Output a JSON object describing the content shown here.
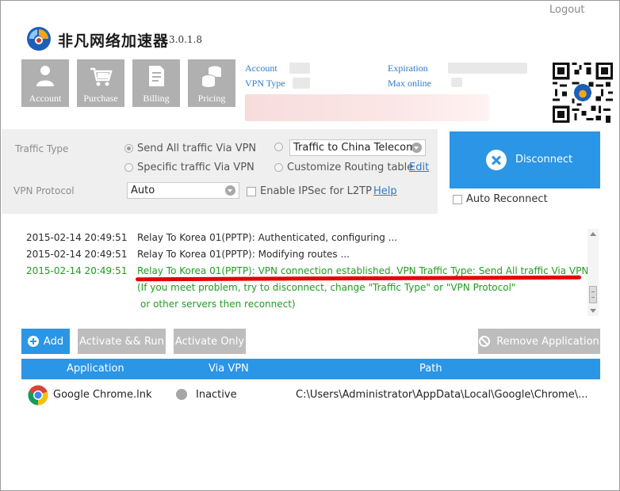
{
  "window": {
    "logout_label": "Logout"
  },
  "header": {
    "app_name": "非凡网络加速器",
    "version": "3.0.1.8"
  },
  "nav": {
    "tiles": [
      {
        "label": "Account",
        "icon": "user-icon"
      },
      {
        "label": "Purchase",
        "icon": "cart-icon"
      },
      {
        "label": "Billing",
        "icon": "document-icon"
      },
      {
        "label": "Pricing",
        "icon": "coins-icon"
      }
    ]
  },
  "account_info": {
    "account_label": "Account",
    "vpn_type_label": "VPN Type",
    "expiration_label": "Expiration",
    "max_online_label": "Max online"
  },
  "settings": {
    "traffic_type_label": "Traffic Type",
    "send_all_label": "Send All traffic Via VPN",
    "specific_label": "Specific traffic Via VPN",
    "traffic_target_value": "Traffic to China Telecom",
    "customize_label": "Customize Routing table",
    "edit_link": "Edit",
    "vpn_protocol_label": "VPN Protocol",
    "protocol_value": "Auto",
    "ipsec_label": "Enable IPSec for L2TP",
    "help_link": "Help"
  },
  "connection": {
    "disconnect_label": "Disconnect",
    "auto_reconnect_label": "Auto Reconnect"
  },
  "log": {
    "entries": [
      {
        "time": "2015-02-14 20:49:51",
        "message": "Relay To Korea 01(PPTP): Authenticated, configuring ..."
      },
      {
        "time": "2015-02-14 20:49:51",
        "message": "Relay To Korea 01(PPTP): Modifying routes ..."
      },
      {
        "time": "2015-02-14 20:49:51",
        "message": "Relay To Korea 01(PPTP): VPN connection established. VPN Traffic Type: Send All traffic Via VPN"
      }
    ],
    "note_line1": "(If you meet problem, try to disconnect, change \"Traffic Type\" or \"VPN Protocol\"",
    "note_line2": "or other servers then reconnect)"
  },
  "apps_toolbar": {
    "add_label": "Add",
    "activate_run_label": "Activate && Run",
    "activate_only_label": "Activate Only",
    "remove_label": "Remove Application"
  },
  "apps_table": {
    "columns": [
      "Application",
      "Via VPN",
      "Path"
    ],
    "rows": [
      {
        "application": "Google Chrome.lnk",
        "via_vpn": "Inactive",
        "path": "C:\\Users\\Administrator\\AppData\\Local\\Google\\Chrome\\..."
      }
    ]
  },
  "colors": {
    "accent": "#2b95e6",
    "success_text": "#1f9d1f",
    "highlight_underline": "#e30000",
    "tile_grey": "#b0b0b0"
  }
}
